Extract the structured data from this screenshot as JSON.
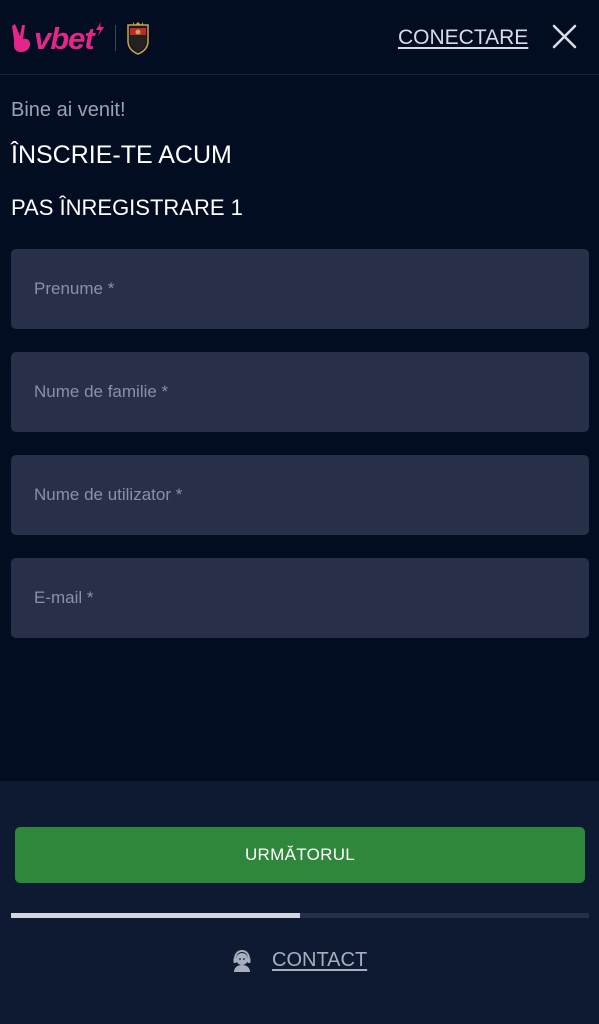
{
  "header": {
    "logo_text": "vbet",
    "login_label": "CONECTARE"
  },
  "form": {
    "welcome": "Bine ai venit!",
    "title": "ÎNSCRIE-TE ACUM",
    "step": "PAS ÎNREGISTRARE 1",
    "fields": [
      {
        "placeholder": "Prenume *",
        "value": ""
      },
      {
        "placeholder": "Nume de familie *",
        "value": ""
      },
      {
        "placeholder": "Nume de utilizator *",
        "value": ""
      },
      {
        "placeholder": "E-mail *",
        "value": ""
      }
    ]
  },
  "footer": {
    "next_label": "URMĂTORUL",
    "progress_fraction": 0.5,
    "contact_label": "CONTACT"
  },
  "colors": {
    "background": "#020d22",
    "brand_pink": "#e4268a",
    "input_bg": "#283049",
    "button_green": "#2e873a",
    "footer_bg": "#0e1a31"
  },
  "icons": {
    "logo_mark": "victory-hand-icon",
    "partner_crest": "club-crest-icon",
    "close": "close-icon",
    "contact": "support-agent-icon"
  }
}
